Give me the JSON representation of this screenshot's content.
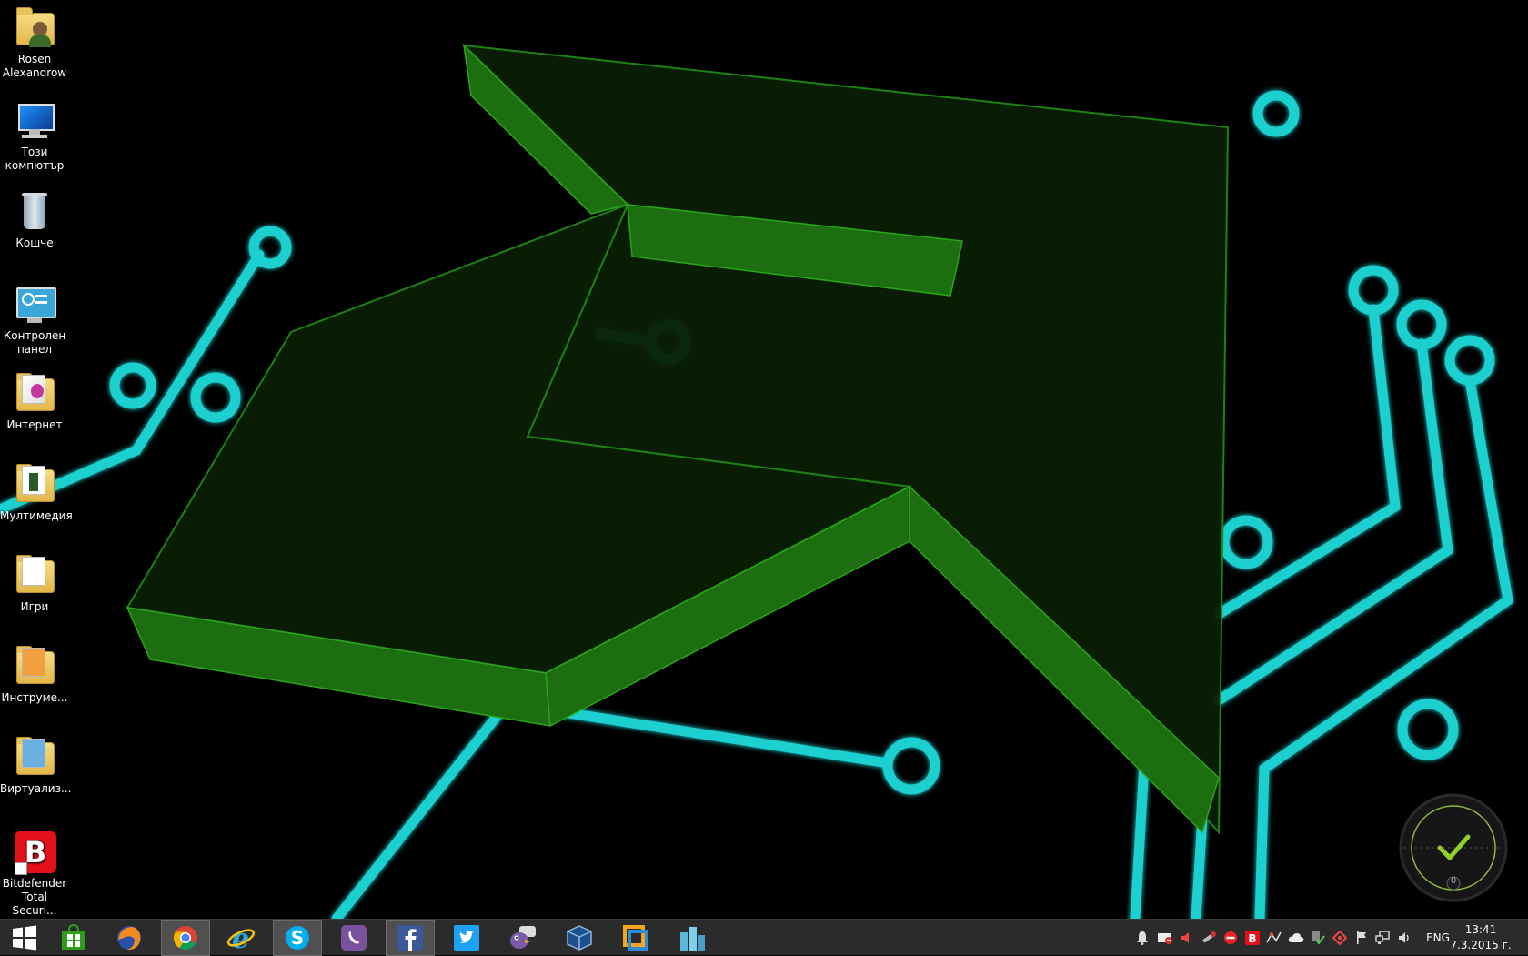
{
  "desktop": {
    "icons": [
      {
        "label": "Rosen\nAlexandrow"
      },
      {
        "label": "Този\nкомпютър"
      },
      {
        "label": "Кошче"
      },
      {
        "label": "Контролен\nпанел"
      },
      {
        "label": "Интернет"
      },
      {
        "label": "Мултимедия"
      },
      {
        "label": "Игри"
      },
      {
        "label": "Инструме..."
      },
      {
        "label": "Виртуализ..."
      },
      {
        "label": "Bitdefender\nTotal Securi..."
      }
    ]
  },
  "gadget": {
    "count": "0"
  },
  "taskbar": {
    "buttons": [
      {
        "name": "start-button",
        "icon": "windows-logo-icon"
      },
      {
        "name": "store-button",
        "icon": "store-icon"
      },
      {
        "name": "firefox-button",
        "icon": "firefox-icon"
      },
      {
        "name": "chrome-button",
        "icon": "chrome-icon",
        "active": true
      },
      {
        "name": "internet-explorer-button",
        "icon": "ie-icon"
      },
      {
        "name": "skype-button",
        "icon": "skype-icon",
        "active": true
      },
      {
        "name": "viber-button",
        "icon": "viber-icon"
      },
      {
        "name": "facebook-button",
        "icon": "facebook-icon",
        "active": true
      },
      {
        "name": "twitter-button",
        "icon": "twitter-icon"
      },
      {
        "name": "pidgin-button",
        "icon": "pidgin-icon"
      },
      {
        "name": "virtualbox-button",
        "icon": "virtualbox-icon"
      },
      {
        "name": "vmware-button",
        "icon": "vmware-icon"
      },
      {
        "name": "city-app-button",
        "icon": "buildings-icon"
      }
    ],
    "tray": {
      "language": "ENG",
      "time": "13:41",
      "date": "7.3.2015 г."
    },
    "colors": {
      "background": "#2b2b2b",
      "accent": "#1fd3d3",
      "wallpaper_green": "#1e7a12"
    }
  }
}
